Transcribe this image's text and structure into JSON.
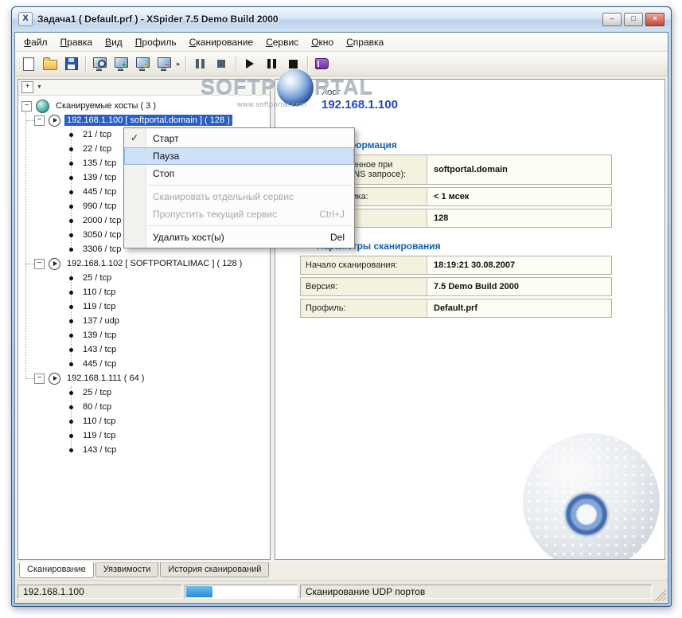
{
  "window": {
    "title": "Задача1 ( Default.prf ) - XSpider 7.5 Demo Build 2000"
  },
  "menubar": {
    "items": [
      "Файл",
      "Правка",
      "Вид",
      "Профиль",
      "Сканирование",
      "Сервис",
      "Окно",
      "Справка"
    ]
  },
  "toolbar": {
    "icons": [
      "new-task",
      "open-task",
      "save-task",
      "check-host",
      "add-host",
      "add-host-range",
      "remove-host",
      "overflow-chevron",
      "pause-all",
      "stop-all",
      "start-scan",
      "pause-scan",
      "stop-scan",
      "help-book"
    ]
  },
  "tree": {
    "root_label": "Сканируемые хосты ( 3 )",
    "hosts": [
      {
        "label": "192.168.1.100 [ softportal.domain ] ( 128 )",
        "ports": [
          "21 / tcp",
          "22 / tcp",
          "135 / tcp",
          "139 / tcp",
          "445 / tcp",
          "990 / tcp",
          "2000 / tcp",
          "3050 / tcp",
          "3306 / tcp"
        ]
      },
      {
        "label": "192.168.1.102 [ SOFTPORTALIMAC ] ( 128 )",
        "ports": [
          "25 / tcp",
          "110 / tcp",
          "119 / tcp",
          "137 / udp",
          "139 / tcp",
          "143 / tcp",
          "445 / tcp"
        ]
      },
      {
        "label": "192.168.1.111 ( 64 )",
        "ports": [
          "25 / tcp",
          "80 / tcp",
          "110 / tcp",
          "119 / tcp",
          "143 / tcp"
        ]
      }
    ]
  },
  "context_menu": {
    "items": [
      {
        "label": "Старт",
        "checked": true
      },
      {
        "label": "Пауза",
        "highlighted": true
      },
      {
        "label": "Стоп"
      },
      {
        "label": "Сканировать отдельный сервис",
        "disabled": true
      },
      {
        "label": "Пропустить текущий сервис",
        "shortcut": "Ctrl+J",
        "disabled": true
      },
      {
        "label": "Удалить хост(ы)",
        "shortcut": "Del"
      }
    ]
  },
  "watermark": {
    "left": "SOFTP",
    "right": "RTAL",
    "url": "www.softportal.com"
  },
  "host_view": {
    "host_label": "Хост",
    "ip": "192.168.1.100",
    "info_header": "Информация",
    "info_rows": [
      {
        "label": "Имя (полученное при обратном DNS запросе):",
        "value": "softportal.domain"
      },
      {
        "label": "Время отклика:",
        "value": "< 1 мсек"
      },
      {
        "label": "",
        "value": "128"
      }
    ],
    "params_header": "Параметры сканирования",
    "params_rows": [
      {
        "label": "Начало сканирования:",
        "value": "18:19:21 30.08.2007"
      },
      {
        "label": "Версия:",
        "value": "7.5 Demo Build 2000"
      },
      {
        "label": "Профиль:",
        "value": "Default.prf"
      }
    ]
  },
  "tabs": {
    "items": [
      {
        "label": "Сканирование"
      },
      {
        "label": "Уязвимости"
      },
      {
        "label": "История сканирований"
      }
    ]
  },
  "statusbar": {
    "host": "192.168.1.100",
    "progress_percent": 24,
    "status": "Сканирование UDP портов"
  }
}
